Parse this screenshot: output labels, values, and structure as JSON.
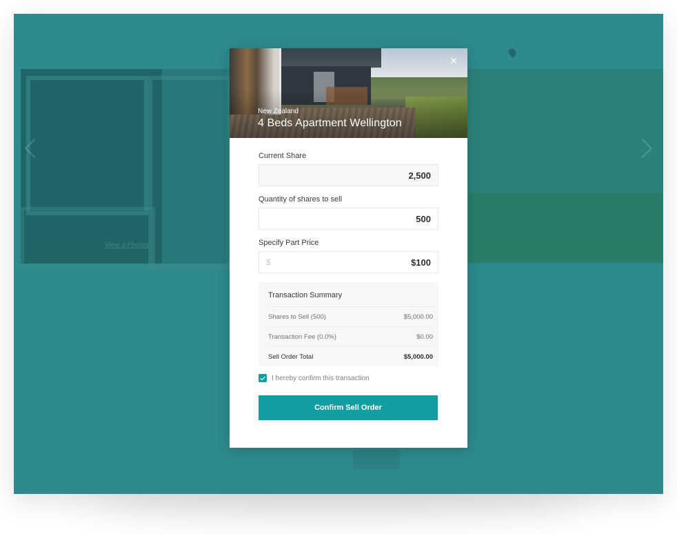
{
  "background": {
    "view_photos_link": "View 4 Photos"
  },
  "modal": {
    "region": "New Zealand",
    "title": "4 Beds Apartment Wellington",
    "close_icon": "×",
    "current_share": {
      "label": "Current Share",
      "value": "2,500"
    },
    "quantity": {
      "label": "Quantity of shares to sell",
      "value": "500"
    },
    "part_price": {
      "label": "Specify Part Price",
      "prefix": "$",
      "value": "$100"
    },
    "summary": {
      "title": "Transaction Summary",
      "rows": [
        {
          "label": "Shares to Sell (500)",
          "amount": "$5,000.00"
        },
        {
          "label": "Transaction Fee (0.0%)",
          "amount": "$0.00"
        }
      ],
      "total": {
        "label": "Sell Order Total",
        "amount": "$5,000.00"
      }
    },
    "confirm_checkbox": {
      "label": "I hereby confirm this transaction",
      "checked": true
    },
    "submit_label": "Confirm Sell Order"
  },
  "colors": {
    "overlay": "#2e8a8c",
    "accent": "#139ea2"
  }
}
